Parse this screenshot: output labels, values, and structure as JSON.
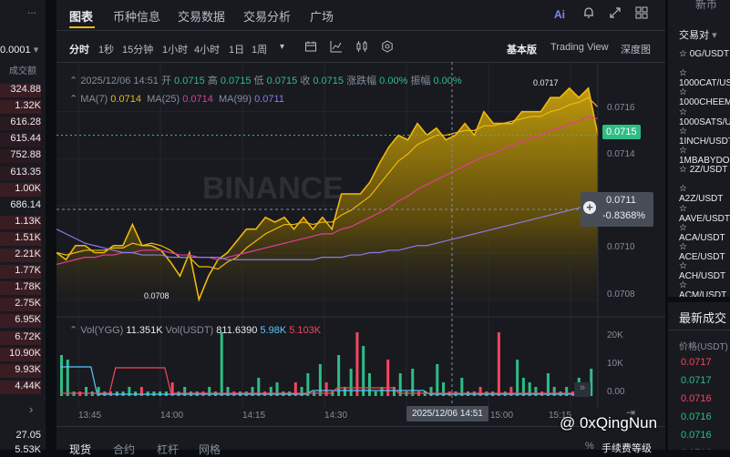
{
  "left_panel": {
    "dots": "...",
    "header_value": "0.0001",
    "column_label": "成交额",
    "rows": [
      {
        "value": "324.88",
        "bg": "#3a1d23"
      },
      {
        "value": "1.32K",
        "bg": "#3a1d23"
      },
      {
        "value": "616.28",
        "bg": "#2a1a1f"
      },
      {
        "value": "615.44",
        "bg": "#2a1a1f"
      },
      {
        "value": "752.88",
        "bg": "#2a1a1f"
      },
      {
        "value": "613.35",
        "bg": "#2a1a1f"
      },
      {
        "value": "1.00K",
        "bg": "#3a1d23"
      },
      {
        "value": "686.14",
        "bg": "#181a20"
      },
      {
        "value": "1.13K",
        "bg": "#3a1d23"
      },
      {
        "value": "1.51K",
        "bg": "#3a1d23"
      },
      {
        "value": "2.21K",
        "bg": "#3a1d23"
      },
      {
        "value": "1.77K",
        "bg": "#3a1d23"
      },
      {
        "value": "1.78K",
        "bg": "#3a1d23"
      },
      {
        "value": "2.75K",
        "bg": "#3a1d23"
      },
      {
        "value": "6.95K",
        "bg": "#3a1d23"
      },
      {
        "value": "6.72K",
        "bg": "#3a1d23"
      },
      {
        "value": "10.90K",
        "bg": "#3a1d23"
      },
      {
        "value": "9.93K",
        "bg": "#3a1d23"
      },
      {
        "value": "4.44K",
        "bg": "#3a1d23"
      }
    ],
    "chevron": "›",
    "bottom_rows": [
      "27.05",
      "5.53K"
    ]
  },
  "tabs": [
    "图表",
    "币种信息",
    "交易数据",
    "交易分析",
    "广场"
  ],
  "intervals": [
    "分时",
    "1秒",
    "15分钟",
    "1小时",
    "4小时",
    "1日",
    "1周"
  ],
  "view_modes": [
    "基本版",
    "Trading View",
    "深度图"
  ],
  "ohlc": {
    "date": "2025/12/06 14:51",
    "open_label": "开",
    "open": "0.0715",
    "high_label": "高",
    "high": "0.0715",
    "low_label": "低",
    "low": "0.0715",
    "close_label": "收",
    "close": "0.0715",
    "change_label": "涨跌幅",
    "change": "0.00%",
    "amplitude_label": "振幅",
    "amplitude": "0.00%"
  },
  "ma": {
    "ma7_label": "MA(7)",
    "ma7": "0.0714",
    "ma25_label": "MA(25)",
    "ma25": "0.0714",
    "ma99_label": "MA(99)",
    "ma99": "0.0711"
  },
  "price_axis": [
    "0.0716",
    "0.0714",
    "0.0710",
    "0.0708"
  ],
  "current_price": "0.0715",
  "cursor_price": "0.0711",
  "cursor_change": "-0.8368%",
  "high_marker": "0.0717",
  "low_marker": "0.0708",
  "watermark": "BINANCE",
  "volume": {
    "label1": "Vol(YGG)",
    "value1": "11.351K",
    "label2": "Vol(USDT)",
    "value2": "811.6390",
    "value3": "5.98K",
    "value4": "5.103K",
    "axis": [
      "20K",
      "10K",
      "0.00"
    ]
  },
  "time_axis": [
    "13:45",
    "14:00",
    "14:15",
    "14:30",
    "14:45",
    "15:00",
    "15:15"
  ],
  "cursor_time": "2025/12/06 14:51",
  "bottom_tabs": [
    "现货",
    "合约",
    "杠杆",
    "网格"
  ],
  "bottom_right": [
    "%",
    "手续费等级"
  ],
  "right_panel": {
    "top_label": "新币",
    "filter": "交易对",
    "pairs": [
      "0G/USDT",
      "1000CAT/USDT",
      "1000CHEEMS/USDT",
      "1000SATS/USDT",
      "1INCH/USDT",
      "1MBABYDOGE/USDT",
      "2Z/USDT",
      "A2Z/USDT",
      "AAVE/USDT",
      "ACA/USDT",
      "ACE/USDT",
      "ACH/USDT",
      "ACM/USDT"
    ],
    "trades_title": "最新成交",
    "price_label": "价格(USDT)",
    "trades": [
      {
        "price": "0.0717",
        "side": "down"
      },
      {
        "price": "0.0717",
        "side": "up"
      },
      {
        "price": "0.0716",
        "side": "down"
      },
      {
        "price": "0.0716",
        "side": "up"
      },
      {
        "price": "0.0716",
        "side": "up"
      },
      {
        "price": "0.0716",
        "side": "down"
      }
    ]
  },
  "overlay_watermark": "@ 0xQingNun",
  "chart_data": {
    "type": "area",
    "x_ticks": [
      "13:45",
      "14:00",
      "14:15",
      "14:30",
      "14:45",
      "15:00",
      "15:15"
    ],
    "y_ticks": [
      "0.0716",
      "0.0714",
      "0.0710",
      "0.0708"
    ],
    "ylim": [
      0.07075,
      0.07175
    ],
    "price": [
      0.071,
      0.07097,
      0.07103,
      0.07103,
      0.071,
      0.071,
      0.07103,
      0.07103,
      0.07112,
      0.07103,
      0.07103,
      0.07101,
      0.07096,
      0.0709,
      0.071,
      0.0708,
      0.0709,
      0.07097,
      0.071,
      0.07105,
      0.0711,
      0.0711,
      0.07115,
      0.07113,
      0.07115,
      0.0711,
      0.07115,
      0.0711,
      0.07115,
      0.0711,
      0.07125,
      0.07125,
      0.07125,
      0.0713,
      0.07138,
      0.07145,
      0.0715,
      0.07148,
      0.07155,
      0.0715,
      0.07153,
      0.07148,
      0.0715,
      0.07155,
      0.0715,
      0.0716,
      0.07155,
      0.07155,
      0.07155,
      0.0716,
      0.0716,
      0.0716,
      0.07166,
      0.07166,
      0.0717,
      0.07166,
      0.0717,
      0.0715
    ],
    "series": [
      {
        "name": "MA(7)",
        "color": "#f0b90b",
        "values": [
          0.071,
          0.07099,
          0.071,
          0.07101,
          0.07101,
          0.07101,
          0.07102,
          0.07102,
          0.07104,
          0.07103,
          0.07104,
          0.07103,
          0.07101,
          0.07098,
          0.07098,
          0.07094,
          0.07094,
          0.07093,
          0.07096,
          0.07098,
          0.07102,
          0.07105,
          0.07108,
          0.0711,
          0.07112,
          0.07112,
          0.07113,
          0.07112,
          0.07113,
          0.07113,
          0.07116,
          0.07118,
          0.07121,
          0.07124,
          0.07129,
          0.07134,
          0.07139,
          0.07142,
          0.07146,
          0.07148,
          0.0715,
          0.0715,
          0.07151,
          0.07152,
          0.07152,
          0.07154,
          0.07154,
          0.07155,
          0.07156,
          0.07157,
          0.07158,
          0.07158,
          0.0716,
          0.07161,
          0.07163,
          0.07164,
          0.07166,
          0.07162
        ]
      },
      {
        "name": "MA(25)",
        "color": "#e23c9b",
        "values": [
          0.07095,
          0.07096,
          0.07097,
          0.07098,
          0.07098,
          0.07099,
          0.07099,
          0.071,
          0.071,
          0.07101,
          0.07101,
          0.07101,
          0.071,
          0.07099,
          0.07099,
          0.07098,
          0.07098,
          0.07097,
          0.07098,
          0.07099,
          0.071,
          0.07101,
          0.07102,
          0.07103,
          0.07104,
          0.07105,
          0.07106,
          0.07107,
          0.07108,
          0.07108,
          0.0711,
          0.07111,
          0.07113,
          0.07115,
          0.07117,
          0.07119,
          0.07122,
          0.07124,
          0.07127,
          0.07129,
          0.07131,
          0.07133,
          0.07135,
          0.07137,
          0.07139,
          0.07141,
          0.07142,
          0.07144,
          0.07146,
          0.07147,
          0.07149,
          0.0715,
          0.07152,
          0.07153,
          0.07155,
          0.07156,
          0.07158,
          0.07157
        ]
      },
      {
        "name": "MA(99)",
        "color": "#8c7ae6",
        "values": [
          0.0711,
          0.07108,
          0.07106,
          0.07104,
          0.07103,
          0.07102,
          0.07101,
          0.071,
          0.071,
          0.07099,
          0.07099,
          0.07099,
          0.07098,
          0.07098,
          0.07098,
          0.07098,
          0.07098,
          0.07098,
          0.07097,
          0.07097,
          0.07097,
          0.07097,
          0.07097,
          0.07097,
          0.07097,
          0.07097,
          0.07097,
          0.07097,
          0.07098,
          0.07098,
          0.07098,
          0.07099,
          0.07099,
          0.071,
          0.071,
          0.07101,
          0.07101,
          0.07102,
          0.07103,
          0.07103,
          0.07104,
          0.07105,
          0.07106,
          0.07107,
          0.07108,
          0.07109,
          0.0711,
          0.07111,
          0.07112,
          0.07113,
          0.07114,
          0.07115,
          0.07116,
          0.07117,
          0.07118,
          0.07119,
          0.07121,
          0.07122
        ]
      }
    ],
    "volume_values": [
      9,
      8,
      1,
      1,
      2,
      1,
      2,
      1,
      1,
      1,
      1,
      2,
      1,
      2,
      1,
      1,
      1,
      1,
      3,
      1,
      2,
      1,
      1,
      1,
      2,
      1,
      14,
      2,
      1,
      1,
      1,
      2,
      4,
      1,
      2,
      3,
      1,
      1,
      3,
      2,
      5,
      1,
      7,
      3,
      1,
      9,
      2,
      6,
      14,
      11,
      5,
      1,
      2,
      8,
      2,
      5,
      1,
      6,
      1,
      1,
      2,
      7,
      3,
      1,
      1,
      4,
      1,
      1,
      2,
      1,
      1,
      14,
      1,
      2,
      8,
      4,
      3,
      2,
      1,
      5,
      2,
      1,
      2,
      1,
      4,
      1,
      6
    ]
  }
}
